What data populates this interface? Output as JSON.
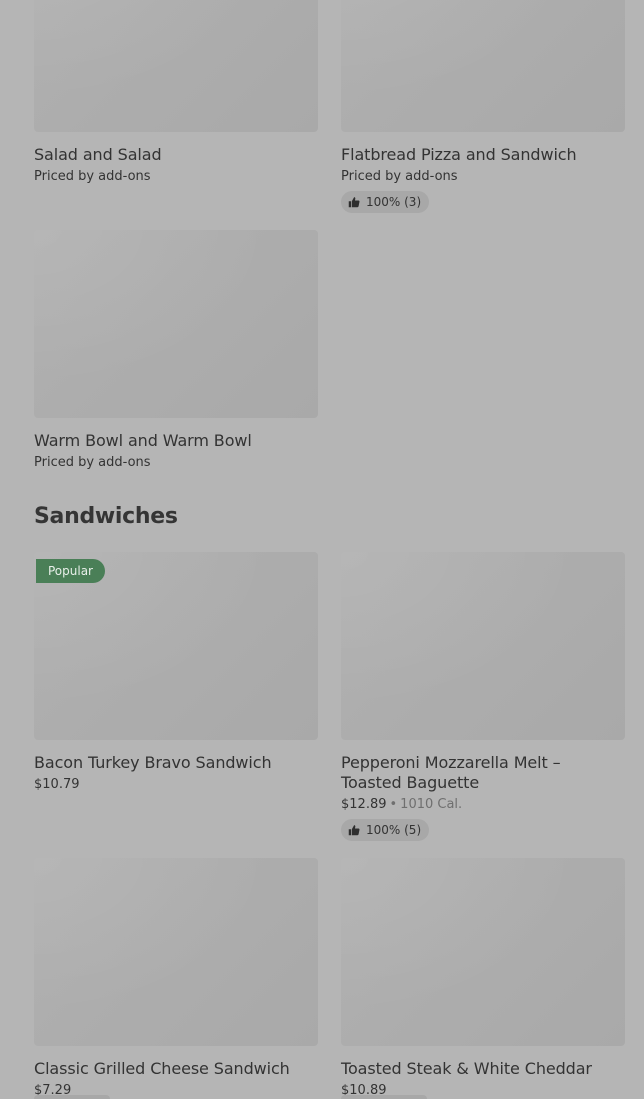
{
  "top_items": [
    {
      "title": "Salad and Salad",
      "sub": "Priced by add-ons"
    },
    {
      "title": "Flatbread Pizza and Sandwich",
      "sub": "Priced by add-ons",
      "rating": "100% (3)"
    },
    {
      "title": "Warm Bowl and Warm Bowl",
      "sub": "Priced by add-ons"
    }
  ],
  "sandwiches": {
    "heading": "Sandwiches",
    "items": [
      {
        "badge": "Popular",
        "title": "Bacon Turkey Bravo Sandwich",
        "price": "$10.79"
      },
      {
        "title": "Pepperoni Mozzarella Melt – Toasted Baguette",
        "price": "$12.89",
        "separator": "•",
        "calories": "1010 Cal.",
        "rating": "100% (5)"
      },
      {
        "title": "Classic Grilled Cheese Sandwich",
        "price": "$7.29"
      },
      {
        "title": "Toasted Steak & White Cheddar",
        "price": "$10.89"
      }
    ]
  },
  "icons": {
    "rating": "thumbs-up-icon"
  },
  "colors": {
    "overlay_bg": "#b5b5b5",
    "badge_bg": "#4a7f57",
    "chip_bg": "#a8a8a8"
  }
}
